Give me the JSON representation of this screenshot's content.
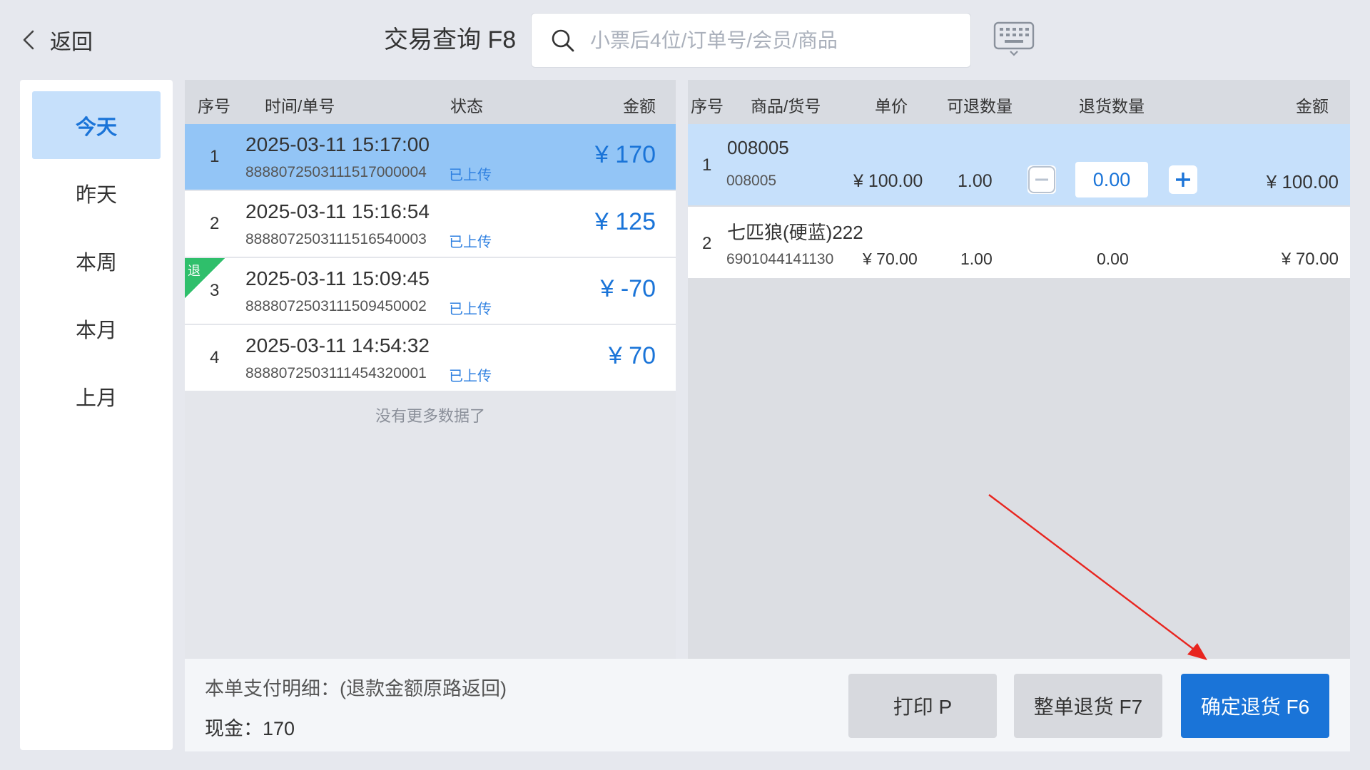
{
  "header": {
    "back_label": "返回",
    "title": "交易查询 F8",
    "search_placeholder": "小票后4位/订单号/会员/商品"
  },
  "date_filters": [
    {
      "label": "今天",
      "active": true
    },
    {
      "label": "昨天",
      "active": false
    },
    {
      "label": "本周",
      "active": false
    },
    {
      "label": "本月",
      "active": false
    },
    {
      "label": "上月",
      "active": false
    }
  ],
  "order_table": {
    "headers": {
      "index": "序号",
      "time_no": "时间/单号",
      "status": "状态",
      "amount": "金额"
    },
    "rows": [
      {
        "index": "1",
        "time": "2025-03-11 15:17:00",
        "order_no": "8888072503111517000004",
        "status": "已上传",
        "amount": "¥ 170",
        "selected": true,
        "return_tag": ""
      },
      {
        "index": "2",
        "time": "2025-03-11 15:16:54",
        "order_no": "8888072503111516540003",
        "status": "已上传",
        "amount": "¥ 125",
        "selected": false,
        "return_tag": ""
      },
      {
        "index": "3",
        "time": "2025-03-11 15:09:45",
        "order_no": "8888072503111509450002",
        "status": "已上传",
        "amount": "¥ -70",
        "selected": false,
        "return_tag": "退"
      },
      {
        "index": "4",
        "time": "2025-03-11 14:54:32",
        "order_no": "8888072503111454320001",
        "status": "已上传",
        "amount": "¥ 70",
        "selected": false,
        "return_tag": ""
      }
    ],
    "no_more_text": "没有更多数据了"
  },
  "detail_table": {
    "headers": {
      "index": "序号",
      "product": "商品/货号",
      "unit_price": "单价",
      "returnable_qty": "可退数量",
      "return_qty": "退货数量",
      "amount": "金额"
    },
    "rows": [
      {
        "index": "1",
        "name": "008005",
        "code": "008005",
        "unit_price": "¥ 100.00",
        "returnable_qty": "1.00",
        "return_qty": "0.00",
        "amount": "¥ 100.00"
      },
      {
        "index": "2",
        "name": "七匹狼(硬蓝)222",
        "code": "6901044141130",
        "unit_price": "¥ 70.00",
        "returnable_qty": "1.00",
        "return_qty": "0.00",
        "amount": "¥ 70.00"
      }
    ]
  },
  "payment": {
    "title": "本单支付明细：(退款金额原路返回)",
    "cash_line": "现金：170"
  },
  "actions": {
    "print_label": "打印 P",
    "full_return_label": "整单退货 F7",
    "confirm_return_label": "确定退货 F6"
  },
  "colors": {
    "accent": "#1a74d8",
    "selected_row": "#93c5f6",
    "selected_filter": "#c6e0fb",
    "return_tag": "#2fbf6b",
    "annotation_arrow": "#e8251f"
  },
  "icons": {
    "back": "chevron-left-icon",
    "search": "search-icon",
    "keyboard": "keyboard-icon",
    "minus": "minus-icon",
    "plus": "plus-icon"
  }
}
